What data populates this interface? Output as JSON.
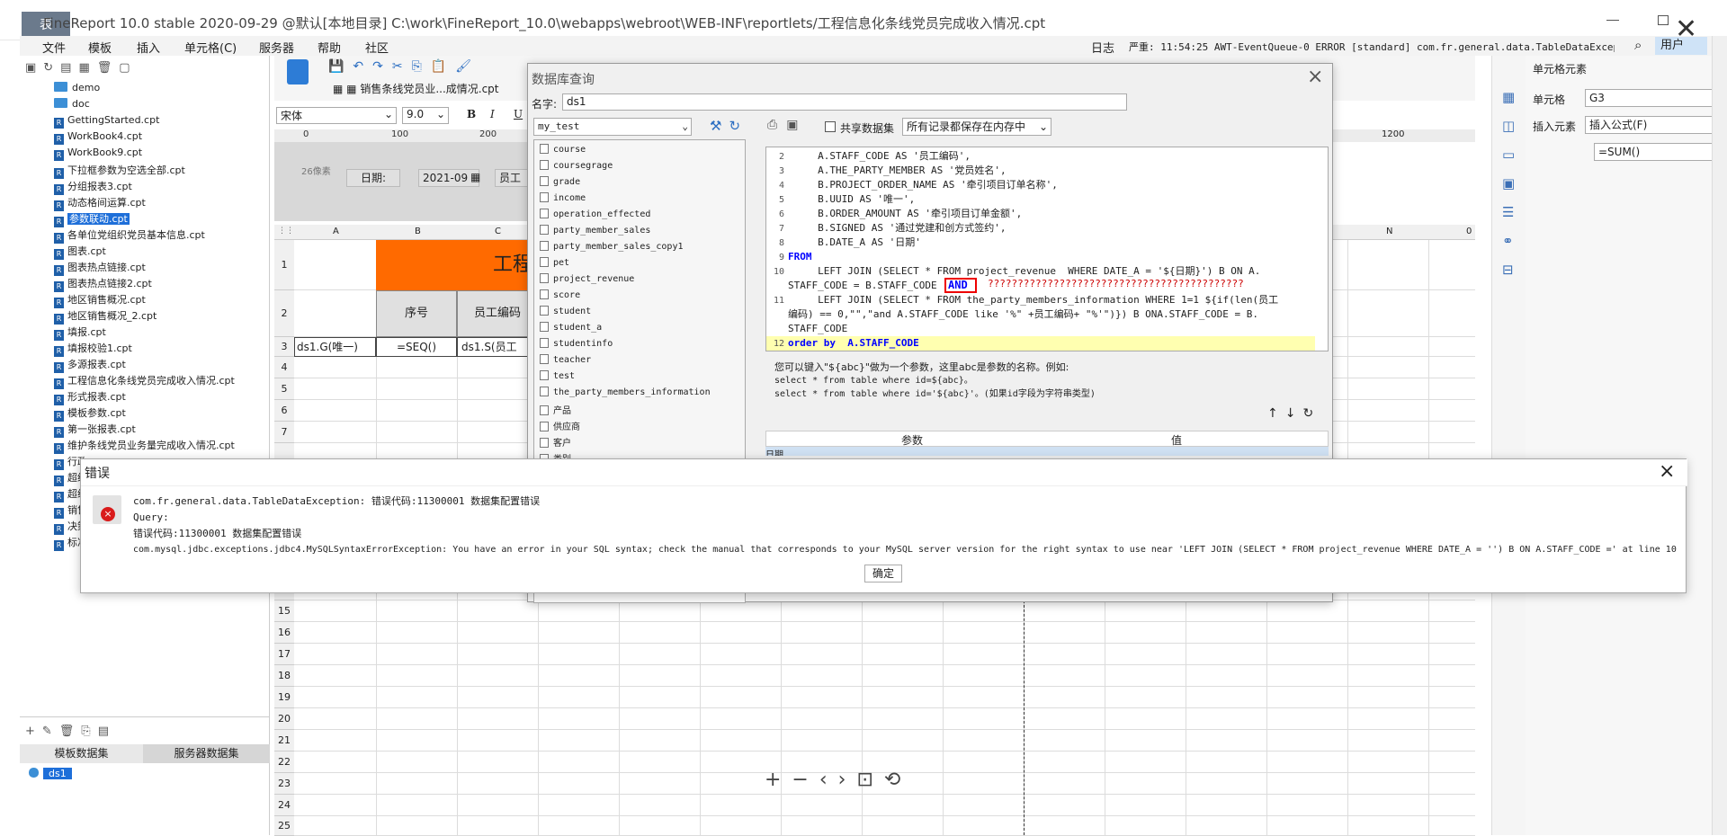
{
  "window": {
    "title": "FineReport 10.0 stable 2020-09-29 @默认[本地目录]    C:\\work\\FineReport_10.0\\webapps\\webroot\\WEB-INF\\reportlets/工程信息化条线党员完成收入情况.cpt",
    "logo": "表"
  },
  "menu": [
    "文件",
    "模板",
    "插入",
    "单元格(C)",
    "服务器",
    "帮助",
    "社区"
  ],
  "log": {
    "label": "日志",
    "text": "严重: 11:54:25 AWT-EventQueue-0 ERROR [standard] com.fr.general.data.TableDataException: 错误...",
    "user": "用户"
  },
  "file_tree": [
    {
      "name": "demo",
      "type": "folder"
    },
    {
      "name": "doc",
      "type": "folder"
    },
    {
      "name": "GettingStarted.cpt",
      "type": "file"
    },
    {
      "name": "WorkBook4.cpt",
      "type": "file"
    },
    {
      "name": "WorkBook9.cpt",
      "type": "file"
    },
    {
      "name": "下拉框参数为空选全部.cpt",
      "type": "file"
    },
    {
      "name": "分组报表3.cpt",
      "type": "file"
    },
    {
      "name": "动态格间运算.cpt",
      "type": "file"
    },
    {
      "name": "参数联动.cpt",
      "type": "file",
      "selected": true
    },
    {
      "name": "各单位党组织党员基本信息.cpt",
      "type": "file"
    },
    {
      "name": "图表.cpt",
      "type": "file"
    },
    {
      "name": "图表热点链接.cpt",
      "type": "file"
    },
    {
      "name": "图表热点链接2.cpt",
      "type": "file"
    },
    {
      "name": "地区销售概况.cpt",
      "type": "file"
    },
    {
      "name": "地区销售概况_2.cpt",
      "type": "file"
    },
    {
      "name": "填报.cpt",
      "type": "file"
    },
    {
      "name": "填报校验1.cpt",
      "type": "file"
    },
    {
      "name": "多源报表.cpt",
      "type": "file"
    },
    {
      "name": "工程信息化条线党员完成收入情况.cpt",
      "type": "file"
    },
    {
      "name": "形式报表.cpt",
      "type": "file"
    },
    {
      "name": "模板参数.cpt",
      "type": "file"
    },
    {
      "name": "第一张报表.cpt",
      "type": "file"
    },
    {
      "name": "维护条线党员业务量完成收入情况.cpt",
      "type": "file"
    },
    {
      "name": "行政",
      "type": "file"
    },
    {
      "name": "超级",
      "type": "file"
    },
    {
      "name": "超级",
      "type": "file"
    },
    {
      "name": "销售",
      "type": "file"
    },
    {
      "name": "决策",
      "type": "file"
    },
    {
      "name": "标准",
      "type": "file"
    }
  ],
  "dataset_tabs": [
    "模板数据集",
    "服务器数据集"
  ],
  "dataset_item": "ds1",
  "report_tab": "销售条线党员业...成情况.cpt",
  "font": {
    "family": "宋体",
    "size": "9.0"
  },
  "param": {
    "width": "26像素",
    "date_label": "日期:",
    "date_value": "2021-09",
    "emp_label": "员工"
  },
  "columns": [
    "A",
    "B",
    "C"
  ],
  "far_col": "N",
  "far_val": "0",
  "ruler": [
    "0",
    "100",
    "200"
  ],
  "ruler_right": "1200",
  "rows": [
    "1",
    "2",
    "3",
    "4",
    "5",
    "6",
    "7",
    "8",
    "15",
    "16",
    "17",
    "18",
    "19",
    "20",
    "21",
    "22",
    "23",
    "24",
    "25"
  ],
  "cells": {
    "title": "工程",
    "seq": "序号",
    "emp": "员工编码",
    "a3": "ds1.G(唯一)",
    "b3": "=SEQ()",
    "c3": "ds1.S(员工"
  },
  "props": {
    "title": "单元格元素",
    "cell_label": "单元格",
    "cell_value": "G3",
    "insert_label": "插入元素",
    "insert_value": "插入公式(F)",
    "formula": "=SUM()"
  },
  "db_dialog": {
    "title": "数据库查询",
    "name_label": "名字:",
    "name_value": "ds1",
    "connection": "my_test",
    "shared": "共享数据集",
    "memory": "所有记录都保存在内存中",
    "tables": [
      "course",
      "coursegrage",
      "grade",
      "income",
      "operation_effected",
      "party_member_sales",
      "party_member_sales_copy1",
      "pet",
      "project_revenue",
      "score",
      "student",
      "student_a",
      "studentinfo",
      "teacher",
      "test",
      "the_party_members_information",
      "产品",
      "供应商",
      "客户",
      "类别"
    ],
    "sql_lines": [
      {
        "n": "2",
        "t": "     A.STAFF_CODE AS '员工编码',"
      },
      {
        "n": "3",
        "t": "     A.THE_PARTY_MEMBER AS '党员姓名',"
      },
      {
        "n": "4",
        "t": "     B.PROJECT_ORDER_NAME AS '牵引项目订单名称',"
      },
      {
        "n": "5",
        "t": "     B.UUID AS '唯一',"
      },
      {
        "n": "6",
        "t": "     B.ORDER_AMOUNT AS '牵引项目订单金额',"
      },
      {
        "n": "7",
        "t": "     B.SIGNED AS '通过党建和创方式签约',"
      },
      {
        "n": "8",
        "t": "     B.DATE_A AS '日期'"
      },
      {
        "n": "9",
        "t": "FROM"
      },
      {
        "n": "10",
        "t": "     LEFT JOIN (SELECT * FROM project_revenue  WHERE DATE_A = '${日期}') B ON A."
      },
      {
        "n": "",
        "t": "STAFF_CODE = B.STAFF_CODE"
      },
      {
        "n": "11",
        "t": "     LEFT JOIN (SELECT * FROM the_party_members_information WHERE 1=1 ${if(len(员工"
      },
      {
        "n": "",
        "t": "编码) == 0,\"\",\"and A.STAFF_CODE like '%\" +员工编码+ \"%'\")}) B ONA.STAFF_CODE = B."
      },
      {
        "n": "",
        "t": "STAFF_CODE"
      },
      {
        "n": "12",
        "t": "order by  A.STAFF_CODE"
      }
    ],
    "and_box": "AND",
    "question_marks": "???????????????????????????????????????????",
    "hint": [
      "您可以键入\"${abc}\"做为一个参数，这里abc是参数的名称。例如:",
      "select * from table where id=${abc}。",
      "select * from table where id='${abc}'。(如果id字段为字符串类型)"
    ],
    "param_cols": [
      "参数",
      "值"
    ],
    "param_row": "日期"
  },
  "error_dialog": {
    "title": "错误",
    "line1": "com.fr.general.data.TableDataException: 错误代码:11300001 数据集配置错误",
    "line2": "Query:",
    "line3": "错误代码:11300001 数据集配置错误",
    "line4": "com.mysql.jdbc.exceptions.jdbc4.MySQLSyntaxErrorException: You have an error in your SQL syntax; check the manual that corresponds to your MySQL server version for the right syntax to use near 'LEFT JOIN (SELECT * FROM project_revenue  WHERE DATE_A = '') B ON A.STAFF_CODE =' at line 10",
    "ok": "确定"
  }
}
